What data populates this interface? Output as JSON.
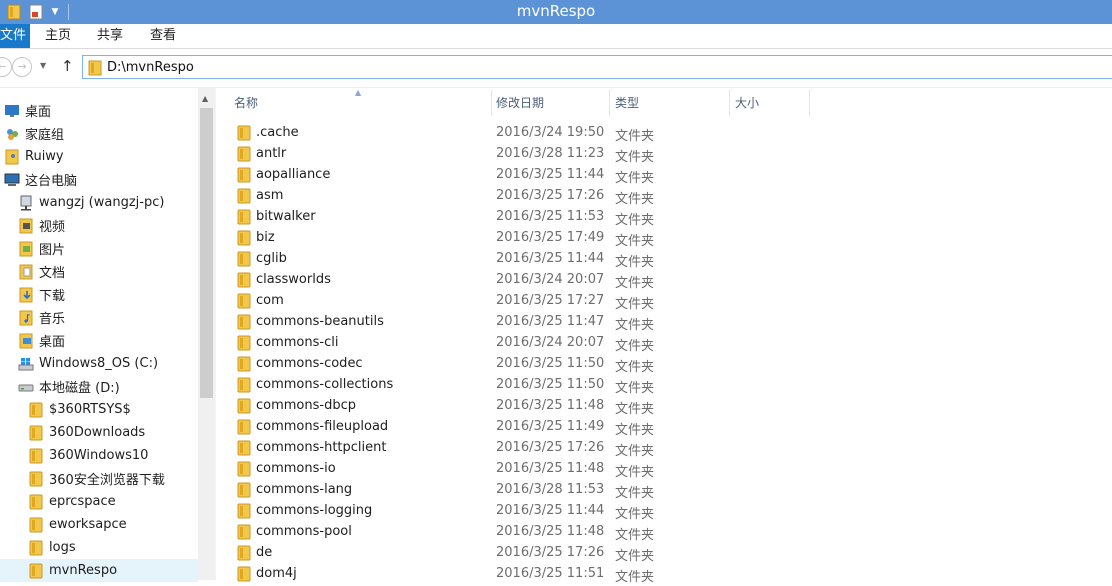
{
  "window": {
    "title": "mvnRespo"
  },
  "ribbon": {
    "file_tab": "文件",
    "tabs": [
      "主页",
      "共享",
      "查看"
    ]
  },
  "address": {
    "path": "D:\\mvnRespo"
  },
  "columns": {
    "name": "名称",
    "date": "修改日期",
    "type": "类型",
    "size": "大小"
  },
  "nav_tree": [
    {
      "label": "桌面",
      "icon": "desktop-icon",
      "indent": 0
    },
    {
      "label": "家庭组",
      "icon": "homegroup-icon",
      "indent": 0
    },
    {
      "label": "Ruiwy",
      "icon": "user-folder-icon",
      "indent": 0
    },
    {
      "label": "这台电脑",
      "icon": "computer-icon",
      "indent": 0
    },
    {
      "label": "wangzj (wangzj-pc)",
      "icon": "network-drive-icon",
      "indent": 1
    },
    {
      "label": "视频",
      "icon": "videos-icon",
      "indent": 1
    },
    {
      "label": "图片",
      "icon": "pictures-icon",
      "indent": 1
    },
    {
      "label": "文档",
      "icon": "documents-icon",
      "indent": 1
    },
    {
      "label": "下载",
      "icon": "downloads-icon",
      "indent": 1
    },
    {
      "label": "音乐",
      "icon": "music-icon",
      "indent": 1
    },
    {
      "label": "桌面",
      "icon": "desktop-folder-icon",
      "indent": 1
    },
    {
      "label": "Windows8_OS (C:)",
      "icon": "windows-drive-icon",
      "indent": 1
    },
    {
      "label": "本地磁盘 (D:)",
      "icon": "drive-icon",
      "indent": 1
    },
    {
      "label": "$360RTSYS$",
      "icon": "folder-icon",
      "indent": 2
    },
    {
      "label": "360Downloads",
      "icon": "folder-icon",
      "indent": 2
    },
    {
      "label": "360Windows10",
      "icon": "folder-icon",
      "indent": 2
    },
    {
      "label": "360安全浏览器下载",
      "icon": "folder-icon",
      "indent": 2
    },
    {
      "label": "eprcspace",
      "icon": "folder-icon",
      "indent": 2
    },
    {
      "label": "eworksapce",
      "icon": "folder-icon",
      "indent": 2
    },
    {
      "label": "logs",
      "icon": "folder-icon",
      "indent": 2
    },
    {
      "label": "mvnRespo",
      "icon": "folder-icon",
      "indent": 2,
      "selected": true
    }
  ],
  "files": [
    {
      "name": ".cache",
      "date": "2016/3/24 19:50",
      "type": "文件夹"
    },
    {
      "name": "antlr",
      "date": "2016/3/28 11:23",
      "type": "文件夹"
    },
    {
      "name": "aopalliance",
      "date": "2016/3/25 11:44",
      "type": "文件夹"
    },
    {
      "name": "asm",
      "date": "2016/3/25 17:26",
      "type": "文件夹"
    },
    {
      "name": "bitwalker",
      "date": "2016/3/25 11:53",
      "type": "文件夹"
    },
    {
      "name": "biz",
      "date": "2016/3/25 17:49",
      "type": "文件夹"
    },
    {
      "name": "cglib",
      "date": "2016/3/25 11:44",
      "type": "文件夹"
    },
    {
      "name": "classworlds",
      "date": "2016/3/24 20:07",
      "type": "文件夹"
    },
    {
      "name": "com",
      "date": "2016/3/25 17:27",
      "type": "文件夹"
    },
    {
      "name": "commons-beanutils",
      "date": "2016/3/25 11:47",
      "type": "文件夹"
    },
    {
      "name": "commons-cli",
      "date": "2016/3/24 20:07",
      "type": "文件夹"
    },
    {
      "name": "commons-codec",
      "date": "2016/3/25 11:50",
      "type": "文件夹"
    },
    {
      "name": "commons-collections",
      "date": "2016/3/25 11:50",
      "type": "文件夹"
    },
    {
      "name": "commons-dbcp",
      "date": "2016/3/25 11:48",
      "type": "文件夹"
    },
    {
      "name": "commons-fileupload",
      "date": "2016/3/25 11:49",
      "type": "文件夹"
    },
    {
      "name": "commons-httpclient",
      "date": "2016/3/25 17:26",
      "type": "文件夹"
    },
    {
      "name": "commons-io",
      "date": "2016/3/25 11:48",
      "type": "文件夹"
    },
    {
      "name": "commons-lang",
      "date": "2016/3/28 11:53",
      "type": "文件夹"
    },
    {
      "name": "commons-logging",
      "date": "2016/3/25 11:44",
      "type": "文件夹"
    },
    {
      "name": "commons-pool",
      "date": "2016/3/25 11:48",
      "type": "文件夹"
    },
    {
      "name": "de",
      "date": "2016/3/25 17:26",
      "type": "文件夹"
    },
    {
      "name": "dom4j",
      "date": "2016/3/25 11:51",
      "type": "文件夹"
    }
  ]
}
